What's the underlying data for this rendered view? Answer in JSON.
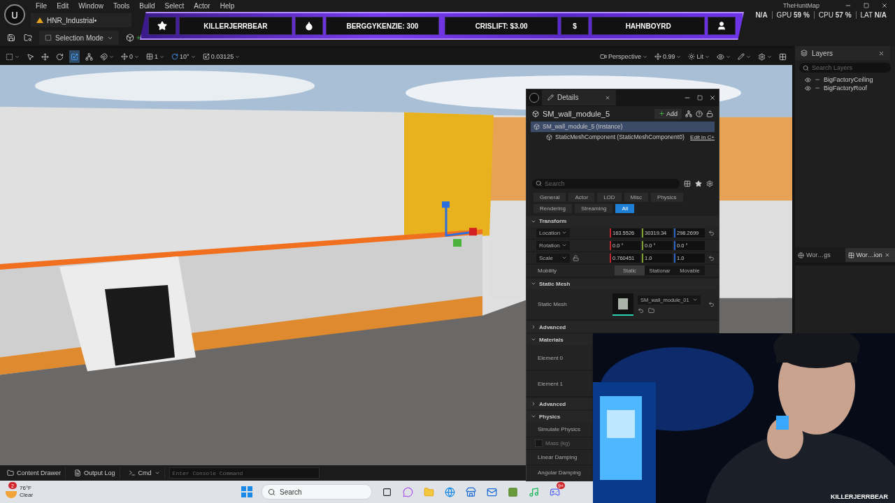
{
  "menu": [
    {
      "label": "File"
    },
    {
      "label": "Edit"
    },
    {
      "label": "Window"
    },
    {
      "label": "Tools"
    },
    {
      "label": "Build"
    },
    {
      "label": "Select"
    },
    {
      "label": "Actor"
    },
    {
      "label": "Help"
    }
  ],
  "project_tab": "HNR_Industrial•",
  "map_title": "TheHuntMap",
  "stats": [
    {
      "value": "N/A"
    },
    {
      "label": "GPU",
      "value": "59 %"
    },
    {
      "label": "CPU",
      "value": "57 %"
    },
    {
      "label": "LAT",
      "value": "N/A"
    }
  ],
  "main_toolbar": {
    "mode": "Selection Mode"
  },
  "viewport_toolbar": {
    "tools": [
      {
        "kind": "select",
        "selected": false
      },
      {
        "kind": "move",
        "selected": false
      },
      {
        "kind": "rotate",
        "selected": false
      },
      {
        "kind": "scale",
        "selected": true
      }
    ],
    "snap_translate": "0",
    "grid": "1",
    "snap_rotate": "10°",
    "snap_scale": "0.03125",
    "view": "Perspective",
    "camera_speed": "0.99",
    "view_mode": "Lit"
  },
  "alerts_banner": [
    {
      "kind": "star"
    },
    {
      "kind": "text",
      "text": "KILLERJERRBEAR"
    },
    {
      "kind": "drop"
    },
    {
      "kind": "text",
      "text": "BERGGYKENZIE: 300"
    },
    {
      "kind": "gap"
    },
    {
      "kind": "text",
      "text": "CRISLIFT: $3.00"
    },
    {
      "kind": "glyph",
      "text": "$"
    },
    {
      "kind": "text",
      "text": "HAHNBOYRD"
    },
    {
      "kind": "user"
    }
  ],
  "details": {
    "tab": "Details",
    "actor": "SM_wall_module_5",
    "add_button": "Add",
    "tree": [
      {
        "label": "SM_wall_module_5 (Instance)",
        "selected": true,
        "children": [
          {
            "label": "StaticMeshComponent (StaticMeshComponent0)",
            "selected": false
          }
        ]
      }
    ],
    "edit_link": "Edit in C+",
    "search_placeholder": "Search",
    "filters": [
      {
        "label": "General",
        "selected": false
      },
      {
        "label": "Actor",
        "selected": false
      },
      {
        "label": "LOD",
        "selected": false
      },
      {
        "label": "Misc",
        "selected": false
      },
      {
        "label": "Physics",
        "selected": false
      },
      {
        "label": "Rendering",
        "selected": false
      },
      {
        "label": "Streaming",
        "selected": false
      },
      {
        "label": "All",
        "selected": true
      }
    ],
    "sections": [
      {
        "title": "Transform",
        "expanded": true,
        "rows": [
          {
            "kind": "vector",
            "label": "Location",
            "values": [
              "163.5526",
              "30319.34",
              "298.2699"
            ],
            "reset": true,
            "lock": false
          },
          {
            "kind": "vector",
            "label": "Rotation",
            "values": [
              "0.0 °",
              "0.0 °",
              "0.0 °"
            ],
            "reset": false,
            "lock": false
          },
          {
            "kind": "vector",
            "label": "Scale",
            "values": [
              "0.760451",
              "1.0",
              "1.0"
            ],
            "reset": true,
            "lock": true
          },
          {
            "kind": "segmented",
            "label": "Mobility",
            "options": [
              {
                "label": "Static",
                "selected": true
              },
              {
                "label": "Stationar",
                "selected": false
              },
              {
                "label": "Movable",
                "selected": false
              }
            ]
          }
        ]
      },
      {
        "title": "Static Mesh",
        "expanded": true,
        "rows": [
          {
            "kind": "asset",
            "label": "Static Mesh",
            "value": "SM_wall_module_01",
            "reset": true
          }
        ]
      },
      {
        "title": "Advanced",
        "expanded": false
      },
      {
        "title": "Materials",
        "expanded": true,
        "rows": [
          {
            "kind": "label",
            "label": "Element 0"
          },
          {
            "kind": "label",
            "label": "Element 1"
          }
        ]
      },
      {
        "title": "Advanced",
        "expanded": false
      },
      {
        "title": "Physics",
        "expanded": true,
        "rows": [
          {
            "kind": "label",
            "label": "Simulate Physics"
          },
          {
            "kind": "checkbox",
            "label": "Mass (kg)",
            "checked": false,
            "disabled": true
          },
          {
            "kind": "label",
            "label": "Linear Damping"
          },
          {
            "kind": "label",
            "label": "Angular Damping"
          }
        ]
      }
    ]
  },
  "layers": {
    "title": "Layers",
    "search_placeholder": "Search Layers",
    "items": [
      {
        "name": "BigFactoryCeiling",
        "visible": true
      },
      {
        "name": "BigFactoryRoof",
        "visible": true
      }
    ],
    "tabs": [
      {
        "label": "Wor…gs",
        "selected": false
      },
      {
        "label": "Wor…ion",
        "selected": true
      }
    ]
  },
  "status_bar": {
    "content_drawer": "Content Drawer",
    "output_log": "Output Log",
    "cmd": "Cmd",
    "console_placeholder": "Enter Console Command"
  },
  "webcam_label": "KILLERJERRBEAR",
  "taskbar": {
    "weather_badge": "2",
    "temperature": "76°F",
    "condition": "Clear",
    "search_placeholder": "Search",
    "discord_badge": "9+"
  }
}
